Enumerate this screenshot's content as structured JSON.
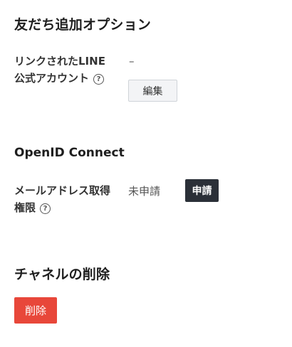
{
  "friend_options": {
    "title": "友だち追加オプション",
    "linked_account": {
      "label_line1": "リンクされたLINE",
      "label_line2": "公式アカウント",
      "help_icon": "help-circle-icon",
      "value": "–",
      "edit_button": "編集"
    }
  },
  "openid": {
    "title": "OpenID Connect",
    "email_permission": {
      "label_line1": "メールアドレス取得",
      "label_line2": "権限",
      "help_icon": "help-circle-icon",
      "status": "未申請",
      "apply_button": "申請"
    }
  },
  "delete_channel": {
    "title": "チャネルの削除",
    "delete_button": "削除"
  },
  "colors": {
    "danger": "#e8473a",
    "dark_button": "#2b3038",
    "light_button_bg": "#f3f4f6"
  }
}
